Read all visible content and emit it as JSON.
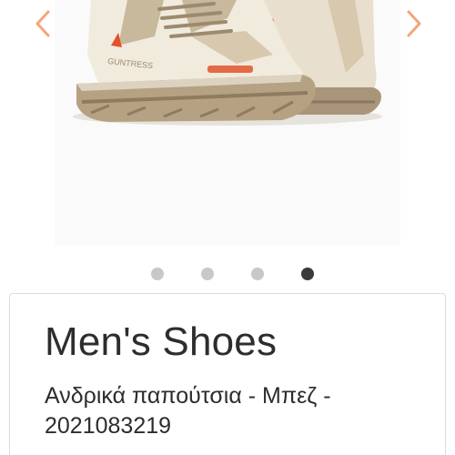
{
  "gallery": {
    "image_icon": "boot-product-image",
    "prev_icon": "chevron-left-icon",
    "next_icon": "chevron-right-icon",
    "arrow_color": "#f4a57c",
    "boot_printed_text": "GUNTRESS",
    "current_slide": 4,
    "slide_count": 4
  },
  "product": {
    "title": "Men's Shoes",
    "subtitle": "Ανδρικά παπούτσια - Μπεζ - 2021083219"
  }
}
